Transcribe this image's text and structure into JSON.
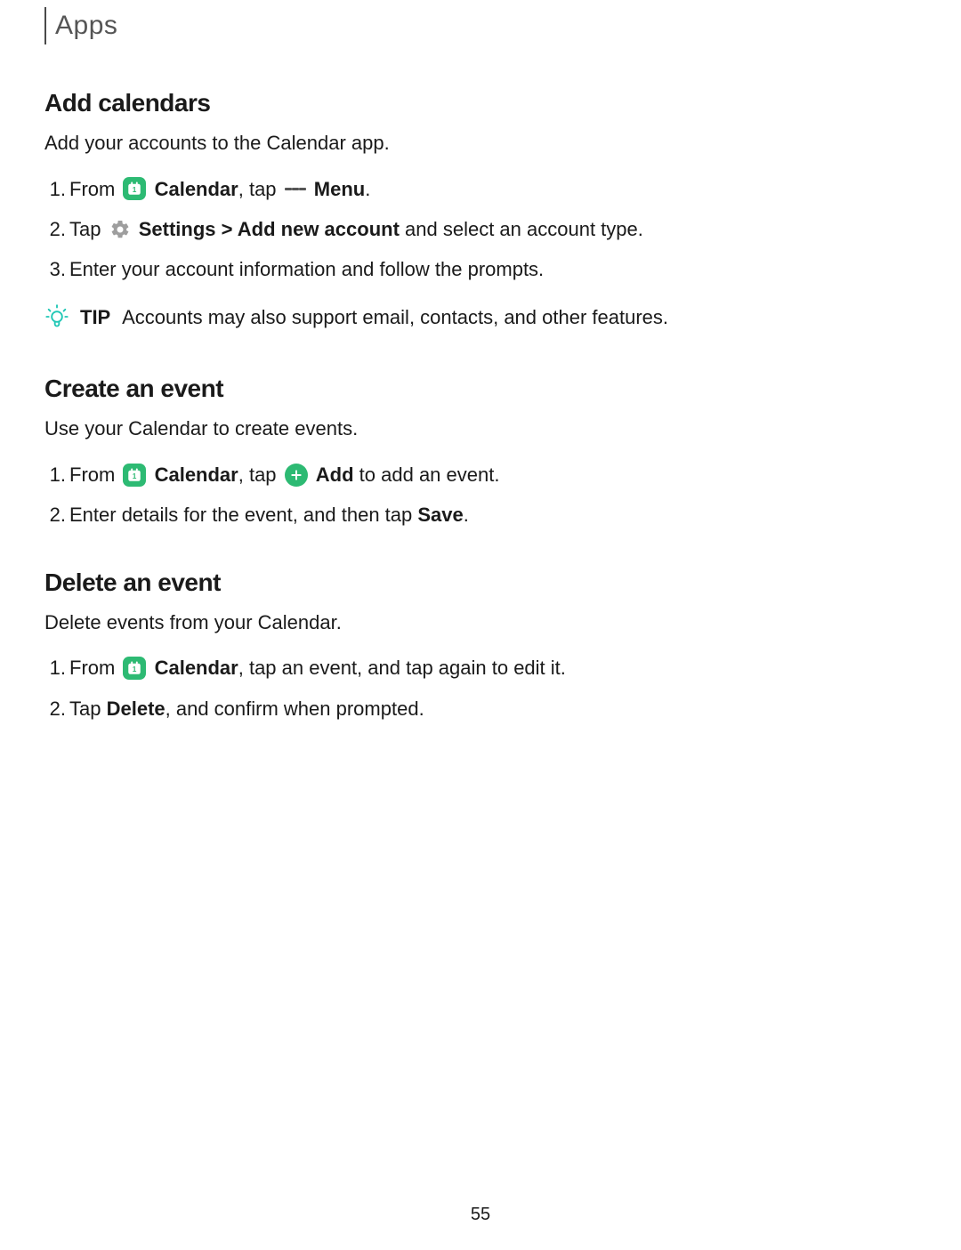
{
  "header": {
    "title": "Apps"
  },
  "section1": {
    "heading": "Add calendars",
    "intro": "Add your accounts to the Calendar app.",
    "step1_pre": "From ",
    "step1_cal_label": "Calendar",
    "step1_mid": ", tap ",
    "step1_menu_label": "Menu",
    "step1_post": ".",
    "step2_pre": "Tap ",
    "step2_settings_label": "Settings",
    "step2_sep": " > ",
    "step2_add_label": "Add new account",
    "step2_post": " and select an account type.",
    "step3": "Enter your account information and follow the prompts.",
    "tip_label": "TIP",
    "tip_text": " Accounts may also support email, contacts, and other features."
  },
  "section2": {
    "heading": "Create an event",
    "intro": "Use your Calendar to create events.",
    "step1_pre": "From ",
    "step1_cal_label": "Calendar",
    "step1_mid": ", tap ",
    "step1_add_label": "Add",
    "step1_post": " to add an event.",
    "step2_pre": "Enter details for the event, and then tap ",
    "step2_save_label": "Save",
    "step2_post": "."
  },
  "section3": {
    "heading": "Delete an event",
    "intro": "Delete events from your Calendar.",
    "step1_pre": "From ",
    "step1_cal_label": "Calendar",
    "step1_post": ", tap an event, and tap again to edit it.",
    "step2_pre": "Tap ",
    "step2_delete_label": "Delete",
    "step2_post": ", and confirm when prompted."
  },
  "page_number": "55"
}
